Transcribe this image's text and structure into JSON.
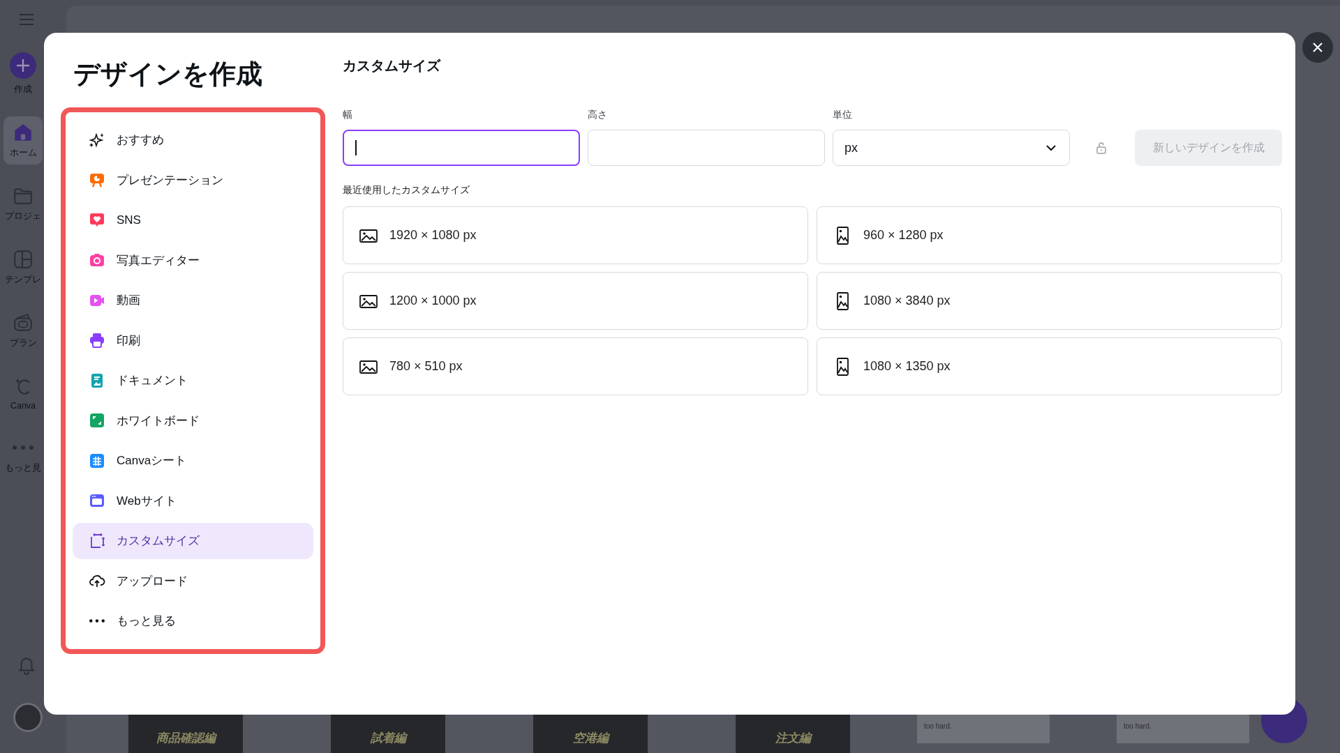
{
  "app_sidebar": {
    "items": [
      {
        "label": "作成",
        "kind": "create",
        "selected": false
      },
      {
        "label": "ホーム",
        "kind": "home",
        "selected": true
      },
      {
        "label": "プロジェ",
        "kind": "folder",
        "selected": false
      },
      {
        "label": "テンプレ",
        "kind": "template",
        "selected": false
      },
      {
        "label": "プラン",
        "kind": "plan",
        "selected": false
      },
      {
        "label": "Canva",
        "kind": "brand",
        "selected": false
      },
      {
        "label": "もっと見",
        "kind": "more",
        "selected": false
      }
    ]
  },
  "background_thumbnails": [
    {
      "kind": "poster",
      "caption": "商品確認編"
    },
    {
      "kind": "poster",
      "caption": "試着編"
    },
    {
      "kind": "poster",
      "caption": "空港編"
    },
    {
      "kind": "poster",
      "caption": "注文編"
    },
    {
      "kind": "note",
      "caption": "too hard."
    },
    {
      "kind": "note",
      "caption": "too hard."
    }
  ],
  "dialog": {
    "title": "デザインを作成",
    "categories": [
      {
        "label": "おすすめ",
        "kind": "sparkle",
        "selected": false
      },
      {
        "label": "プレゼンテーション",
        "kind": "presentation",
        "selected": false
      },
      {
        "label": "SNS",
        "kind": "social",
        "selected": false
      },
      {
        "label": "写真エディター",
        "kind": "camera",
        "selected": false
      },
      {
        "label": "動画",
        "kind": "video",
        "selected": false
      },
      {
        "label": "印刷",
        "kind": "print",
        "selected": false
      },
      {
        "label": "ドキュメント",
        "kind": "doc",
        "selected": false
      },
      {
        "label": "ホワイトボード",
        "kind": "whiteboard",
        "selected": false
      },
      {
        "label": "Canvaシート",
        "kind": "sheet",
        "selected": false
      },
      {
        "label": "Webサイト",
        "kind": "website",
        "selected": false
      },
      {
        "label": "カスタムサイズ",
        "kind": "custom",
        "selected": true
      },
      {
        "label": "アップロード",
        "kind": "upload",
        "selected": false
      },
      {
        "label": "もっと見る",
        "kind": "more",
        "selected": false
      }
    ],
    "panel": {
      "heading": "カスタムサイズ",
      "fields": [
        {
          "label": "幅",
          "kind": "text",
          "focused": true
        },
        {
          "label": "高さ",
          "kind": "text",
          "focused": false
        },
        {
          "label": "単位",
          "kind": "select",
          "value": "px",
          "focused": false
        }
      ],
      "create_button": {
        "label": "新しいデザインを作成",
        "disabled": true
      },
      "recent_heading": "最近使用したカスタムサイズ",
      "recent_sizes": [
        {
          "text": "1920 × 1080 px",
          "kind": "landscape"
        },
        {
          "text": "960 × 1280 px",
          "kind": "portrait"
        },
        {
          "text": "1200 × 1000 px",
          "kind": "landscape"
        },
        {
          "text": "1080 × 3840 px",
          "kind": "portrait"
        },
        {
          "text": "780 × 510 px",
          "kind": "landscape"
        },
        {
          "text": "1080 × 1350 px",
          "kind": "portrait"
        }
      ]
    }
  }
}
